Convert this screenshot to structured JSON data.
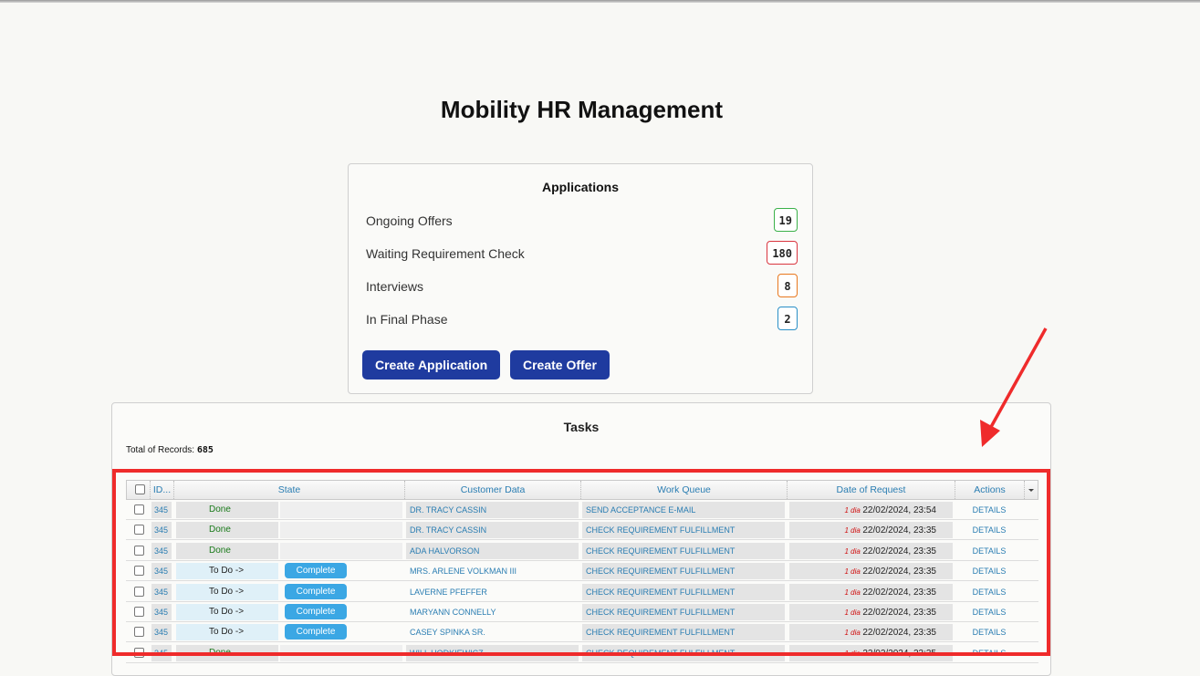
{
  "page": {
    "title": "Mobility HR Management"
  },
  "applications": {
    "title": "Applications",
    "items": [
      {
        "label": "Ongoing Offers",
        "count": "19",
        "color": "#3bb14a"
      },
      {
        "label": "Waiting Requirement Check",
        "count": "180",
        "color": "#d9353f"
      },
      {
        "label": "Interviews",
        "count": "8",
        "color": "#e8781f"
      },
      {
        "label": "In Final Phase",
        "count": "2",
        "color": "#2a8fc7"
      }
    ],
    "buttons": {
      "create_application": "Create Application",
      "create_offer": "Create Offer"
    }
  },
  "tasks": {
    "title": "Tasks",
    "total_label": "Total of Records:",
    "total_value": "685",
    "columns": [
      "ID...",
      "State",
      "Customer Data",
      "Work Queue",
      "Date of Request",
      "Actions"
    ],
    "complete_label": "Complete",
    "rows": [
      {
        "id": "345",
        "state": "Done",
        "customer": "DR. TRACY CASSIN",
        "queue": "SEND ACCEPTANCE E-MAIL",
        "dia": "1 dia",
        "date": "22/02/2024, 23:54",
        "action": "DETAILS"
      },
      {
        "id": "345",
        "state": "Done",
        "customer": "DR. TRACY CASSIN",
        "queue": "CHECK REQUIREMENT FULFILLMENT",
        "dia": "1 dia",
        "date": "22/02/2024, 23:35",
        "action": "DETAILS"
      },
      {
        "id": "345",
        "state": "Done",
        "customer": "ADA HALVORSON",
        "queue": "CHECK REQUIREMENT FULFILLMENT",
        "dia": "1 dia",
        "date": "22/02/2024, 23:35",
        "action": "DETAILS"
      },
      {
        "id": "345",
        "state": "To Do ->",
        "customer": "MRS. ARLENE VOLKMAN III",
        "queue": "CHECK REQUIREMENT FULFILLMENT",
        "dia": "1 dia",
        "date": "22/02/2024, 23:35",
        "action": "DETAILS"
      },
      {
        "id": "345",
        "state": "To Do ->",
        "customer": "LAVERNE PFEFFER",
        "queue": "CHECK REQUIREMENT FULFILLMENT",
        "dia": "1 dia",
        "date": "22/02/2024, 23:35",
        "action": "DETAILS"
      },
      {
        "id": "345",
        "state": "To Do ->",
        "customer": "MARYANN CONNELLY",
        "queue": "CHECK REQUIREMENT FULFILLMENT",
        "dia": "1 dia",
        "date": "22/02/2024, 23:35",
        "action": "DETAILS"
      },
      {
        "id": "345",
        "state": "To Do ->",
        "customer": "CASEY SPINKA SR.",
        "queue": "CHECK REQUIREMENT FULFILLMENT",
        "dia": "1 dia",
        "date": "22/02/2024, 23:35",
        "action": "DETAILS"
      },
      {
        "id": "345",
        "state": "Done",
        "customer": "WILL HODKIEWICZ",
        "queue": "CHECK REQUIREMENT FULFILLMENT",
        "dia": "1 dia",
        "date": "22/02/2024, 23:35",
        "action": "DETAILS"
      }
    ]
  },
  "annotation": {
    "color": "#ef2b2b"
  }
}
